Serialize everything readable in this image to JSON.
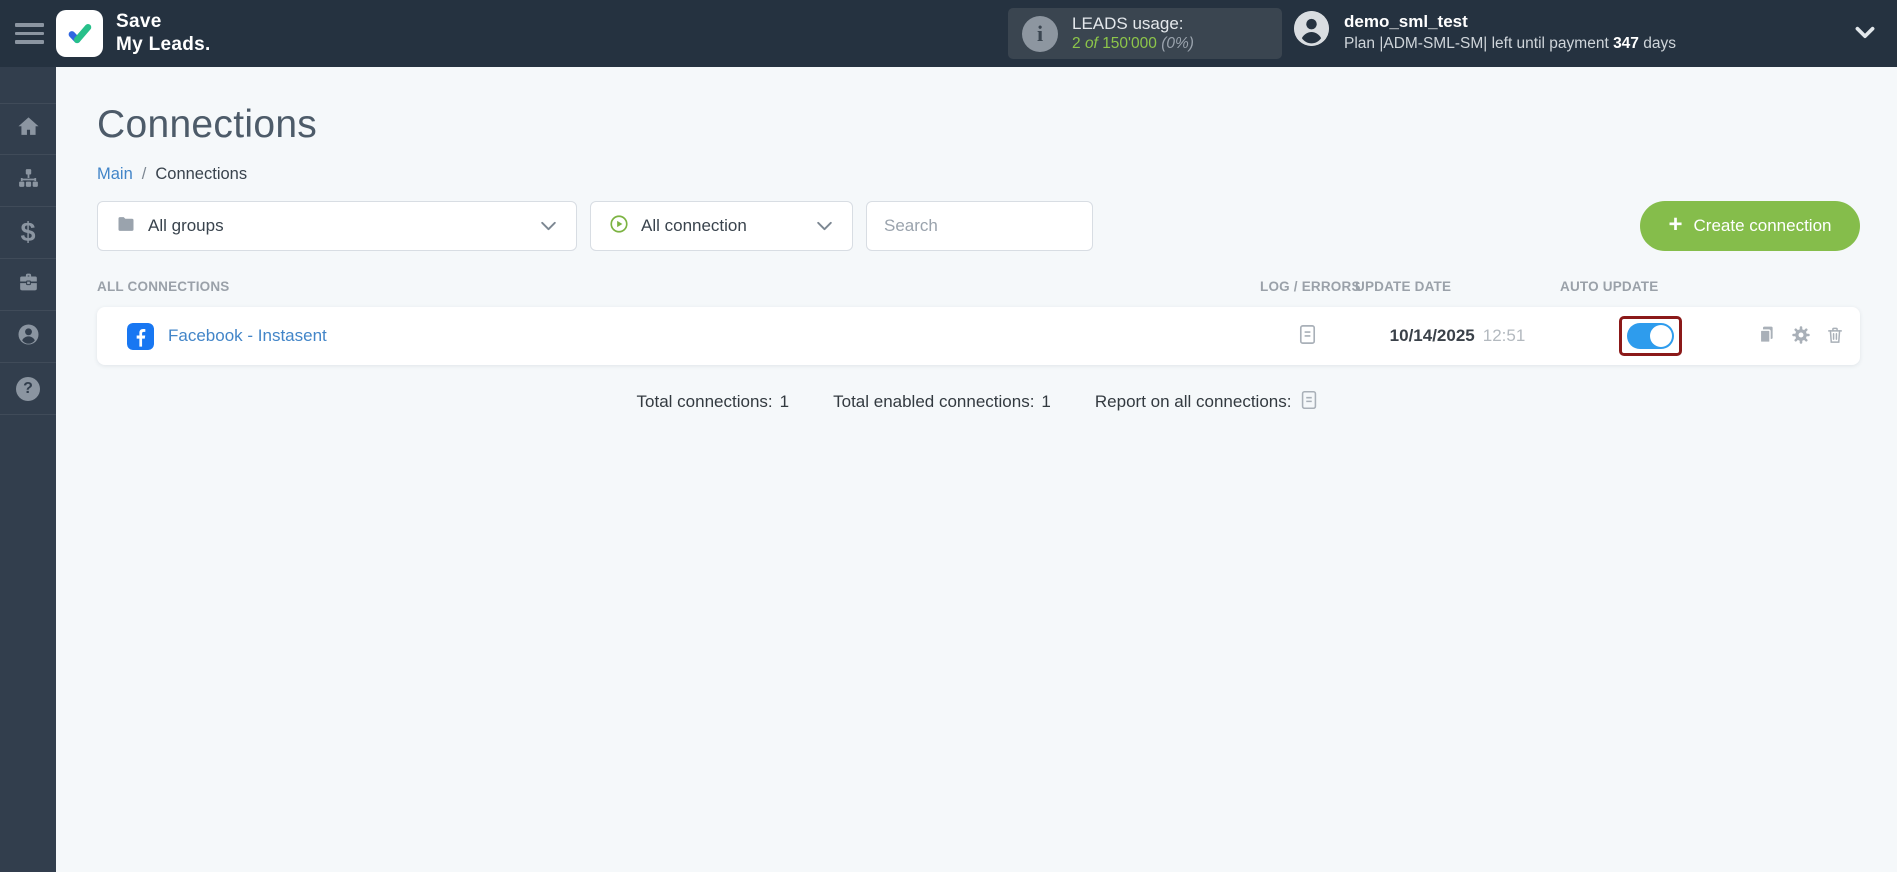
{
  "header": {
    "logo": {
      "line1": "Save",
      "line2": "My Leads."
    },
    "leads_usage": {
      "label": "LEADS usage:",
      "used": "2",
      "of_word": "of",
      "total": "150'000",
      "percent": "(0%)"
    },
    "user": {
      "name": "demo_sml_test",
      "plan_prefix": "Plan |ADM-SML-SM| left until payment",
      "days": "347",
      "days_suffix": "days"
    }
  },
  "sidebar": {
    "items": [
      {
        "icon": "home-icon"
      },
      {
        "icon": "sitemap-icon"
      },
      {
        "icon": "billing-icon"
      },
      {
        "icon": "services-icon"
      },
      {
        "icon": "profile-icon"
      },
      {
        "icon": "help-icon"
      }
    ]
  },
  "page": {
    "title": "Connections",
    "breadcrumb": {
      "main": "Main",
      "separator": "/",
      "current": "Connections"
    }
  },
  "filters": {
    "groups_selected": "All groups",
    "connection_selected": "All connection",
    "search_placeholder": "Search"
  },
  "actions": {
    "create_label": "Create connection",
    "plus": "+"
  },
  "table": {
    "headers": [
      "ALL CONNECTIONS",
      "LOG / ERRORS",
      "UPDATE DATE",
      "AUTO UPDATE"
    ],
    "rows": [
      {
        "name": "Facebook - Instasent",
        "service_icon": "facebook-icon",
        "log_icon": "document-icon",
        "date": "10/14/2025",
        "time": "12:51",
        "auto_update_enabled": true
      }
    ]
  },
  "summary": {
    "total": {
      "label": "Total connections:",
      "value": "1"
    },
    "enabled": {
      "label": "Total enabled connections:",
      "value": "1"
    },
    "report": {
      "label": "Report on all connections:"
    }
  },
  "colors": {
    "header_bg": "#253240",
    "sidebar_bg": "#323e4d",
    "page_bg": "#f5f8fa",
    "accent_green": "#85bd4b",
    "link_blue": "#4285c8",
    "toggle_blue": "#2e9ced",
    "highlight_red": "#8b1919",
    "facebook_blue": "#1877f2",
    "leads_green": "#8dc64a"
  }
}
